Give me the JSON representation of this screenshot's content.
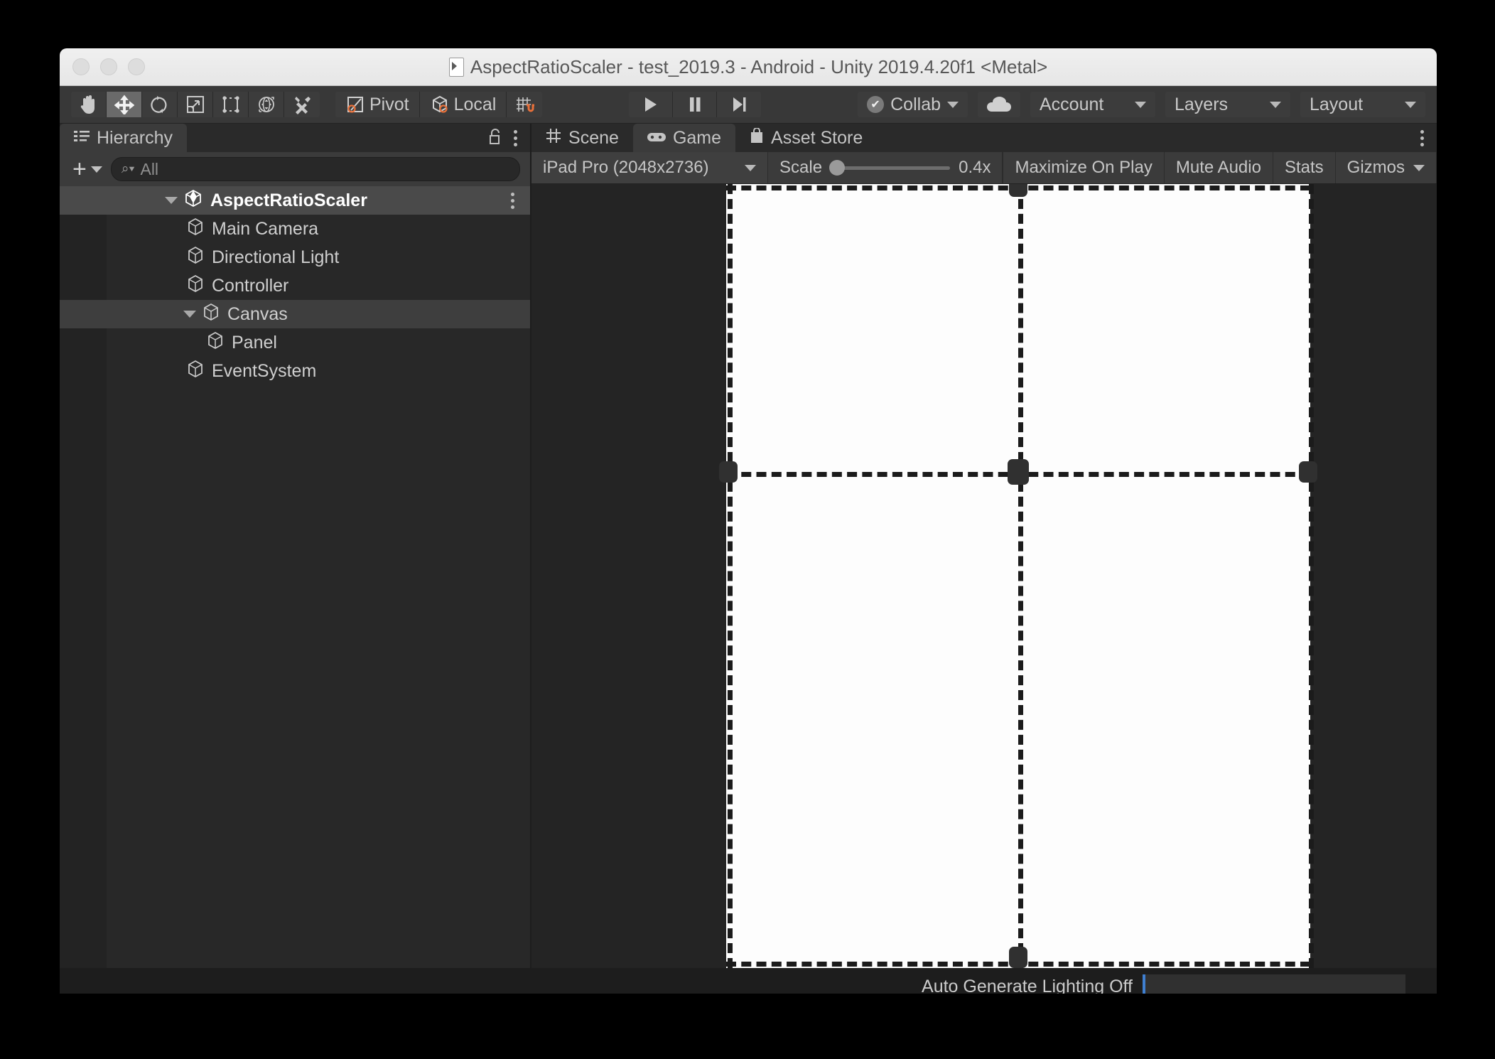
{
  "window": {
    "title": "AspectRatioScaler - test_2019.3 - Android - Unity 2019.4.20f1 <Metal>",
    "app_icon": "unity-document-icon",
    "traffic_lights": [
      "close-button",
      "minimize-button",
      "zoom-button"
    ]
  },
  "toolbar": {
    "transform_tools": [
      {
        "name": "hand-tool",
        "icon": "hand-icon",
        "active": false
      },
      {
        "name": "move-tool",
        "icon": "move-arrows-icon",
        "active": true
      },
      {
        "name": "rotate-tool",
        "icon": "rotate-icon",
        "active": false
      },
      {
        "name": "scale-tool",
        "icon": "scale-icon",
        "active": false
      },
      {
        "name": "rect-tool",
        "icon": "rect-transform-icon",
        "active": false
      },
      {
        "name": "transform-tool",
        "icon": "combined-transform-icon",
        "active": false
      },
      {
        "name": "custom-editor-tool",
        "icon": "wrench-pencil-icon",
        "active": false
      }
    ],
    "pivot_label": "Pivot",
    "pivot_icon": "pivot-icon",
    "local_label": "Local",
    "local_icon": "local-cube-icon",
    "snap_icon": "grid-snap-magnet-icon",
    "play_label": "play-button",
    "pause_label": "pause-button",
    "step_label": "step-button",
    "collab_label": "Collab",
    "collab_icon": "collab-check-icon",
    "cloud_icon": "cloud-icon",
    "account_label": "Account",
    "layers_label": "Layers",
    "layout_label": "Layout"
  },
  "hierarchy": {
    "tab_label": "Hierarchy",
    "tab_icon": "hierarchy-list-icon",
    "lock_icon": "lock-open-icon",
    "menu_icon": "kebab-menu-icon",
    "create_label": "+",
    "search_placeholder": "All",
    "search_value": "",
    "search_icon": "search-icon",
    "items": [
      {
        "label": "AspectRatioScaler",
        "icon": "unity-scene-icon",
        "depth": 0,
        "expanded": true,
        "selected": true,
        "bold": true,
        "has_menu": true
      },
      {
        "label": "Main Camera",
        "icon": "gameobject-cube-icon",
        "depth": 1,
        "expanded": null,
        "selected": false,
        "bold": false,
        "has_menu": false
      },
      {
        "label": "Directional Light",
        "icon": "gameobject-cube-icon",
        "depth": 1,
        "expanded": null,
        "selected": false,
        "bold": false,
        "has_menu": false
      },
      {
        "label": "Controller",
        "icon": "gameobject-cube-icon",
        "depth": 1,
        "expanded": null,
        "selected": false,
        "bold": false,
        "has_menu": false
      },
      {
        "label": "Canvas",
        "icon": "gameobject-cube-icon",
        "depth": 1,
        "expanded": true,
        "selected": true,
        "bold": false,
        "has_menu": false
      },
      {
        "label": "Panel",
        "icon": "gameobject-cube-icon",
        "depth": 2,
        "expanded": null,
        "selected": false,
        "bold": false,
        "has_menu": false
      },
      {
        "label": "EventSystem",
        "icon": "gameobject-cube-icon",
        "depth": 1,
        "expanded": null,
        "selected": false,
        "bold": false,
        "has_menu": false
      }
    ]
  },
  "view_tabs": [
    {
      "label": "Scene",
      "icon": "scene-grid-icon",
      "active": false
    },
    {
      "label": "Game",
      "icon": "gamepad-icon",
      "active": true
    },
    {
      "label": "Asset Store",
      "icon": "shopping-bag-icon",
      "active": false
    }
  ],
  "view_tabs_menu_icon": "kebab-menu-icon",
  "game_toolbar": {
    "resolution_label": "iPad Pro (2048x2736)",
    "scale_label": "Scale",
    "scale_value": "0.4x",
    "scale_percent": 4,
    "maximize_label": "Maximize On Play",
    "mute_label": "Mute Audio",
    "stats_label": "Stats",
    "gizmos_label": "Gizmos"
  },
  "game_view": {
    "canvas_color": "#fdfdfd",
    "background_color": "#242424",
    "selection_outline": "dashed",
    "handles": [
      "center-pivot-handle",
      "left-middle-handle",
      "right-middle-handle",
      "top-middle-handle",
      "bottom-middle-handle"
    ]
  },
  "status_bar": {
    "message": "Auto Generate Lighting Off"
  },
  "colors": {
    "accent_orange": "#e8703a",
    "accent_blue": "#3f7fd0",
    "toolbar_bg": "#383838",
    "panel_bg": "#282828",
    "window_bg": "#1d1d1d"
  }
}
